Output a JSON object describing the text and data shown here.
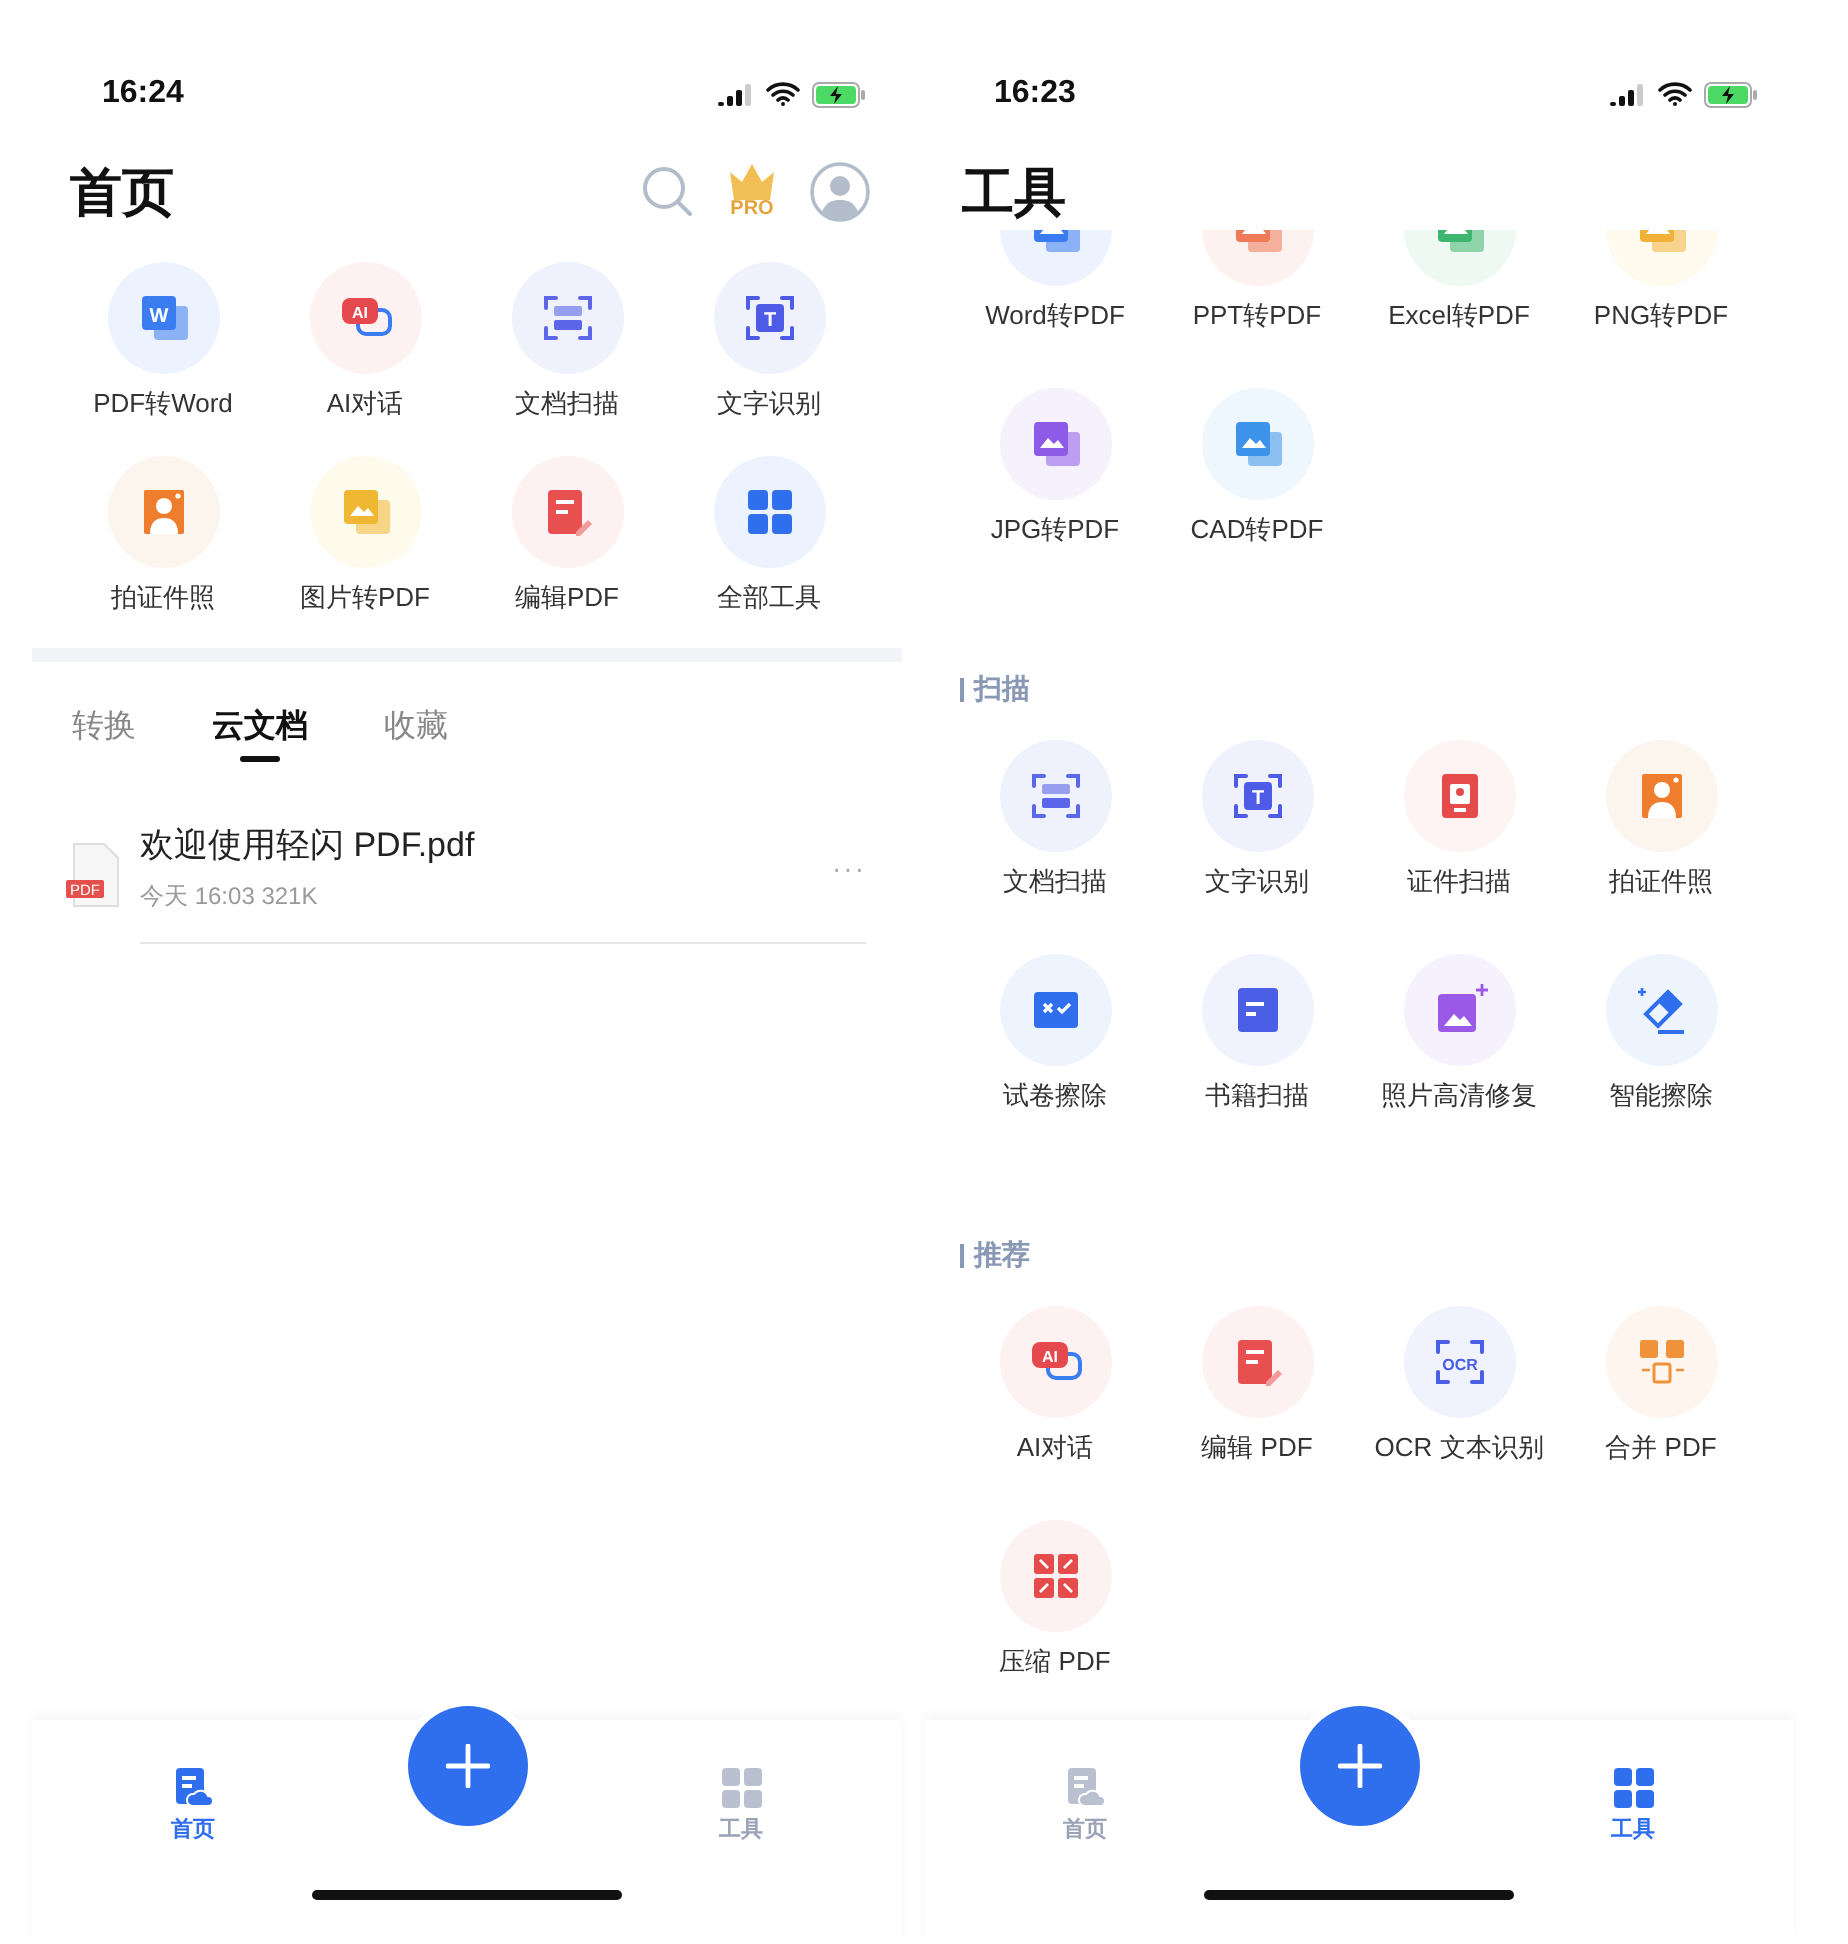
{
  "screens": [
    {
      "kind": "home",
      "status_bar": {
        "time": "16:24"
      },
      "title": "首页",
      "pro_badge": "PRO",
      "tools": [
        {
          "kind": "word",
          "label": "PDF转Word",
          "icon_text": "W"
        },
        {
          "kind": "ai",
          "label": "AI对话",
          "icon_text": "AI"
        },
        {
          "kind": "scan",
          "label": "文档扫描"
        },
        {
          "kind": "text",
          "label": "文字识别",
          "icon_text": "T"
        },
        {
          "kind": "idphoto",
          "label": "拍证件照"
        },
        {
          "kind": "image",
          "label": "图片转PDF"
        },
        {
          "kind": "edit",
          "label": "编辑PDF"
        },
        {
          "kind": "grid",
          "label": "全部工具"
        }
      ],
      "tabs": [
        {
          "label": "转换",
          "selected": false
        },
        {
          "label": "云文档",
          "selected": true
        },
        {
          "label": "收藏",
          "selected": false
        }
      ],
      "files": [
        {
          "name": "欢迎使用轻闪 PDF.pdf",
          "meta": "今天 16:03 321K",
          "badge": "PDF",
          "more": "···"
        }
      ],
      "bottom_nav": [
        {
          "kind": "home",
          "label": "首页",
          "selected": true
        },
        {
          "kind": "tools",
          "label": "工具",
          "selected": false
        }
      ]
    },
    {
      "kind": "tools",
      "status_bar": {
        "time": "16:23"
      },
      "title": "工具",
      "sections": [
        {
          "tools": [
            {
              "kind": "word",
              "label": "Word转PDF"
            },
            {
              "kind": "ppt",
              "label": "PPT转PDF"
            },
            {
              "kind": "excel",
              "label": "Excel转PDF"
            },
            {
              "kind": "png",
              "label": "PNG转PDF"
            },
            {
              "kind": "jpg",
              "label": "JPG转PDF"
            },
            {
              "kind": "cad",
              "label": "CAD转PDF"
            }
          ]
        },
        {
          "title": "扫描",
          "tools": [
            {
              "kind": "scan",
              "label": "文档扫描"
            },
            {
              "kind": "text",
              "label": "文字识别",
              "icon_text": "T"
            },
            {
              "kind": "card",
              "label": "证件扫描"
            },
            {
              "kind": "idphoto",
              "label": "拍证件照"
            },
            {
              "kind": "exam",
              "label": "试卷擦除"
            },
            {
              "kind": "book",
              "label": "书籍扫描"
            },
            {
              "kind": "photofix",
              "label": "照片高清修复"
            },
            {
              "kind": "eraser",
              "label": "智能擦除"
            }
          ]
        },
        {
          "title": "推荐",
          "tools": [
            {
              "kind": "ai",
              "label": "AI对话",
              "icon_text": "AI"
            },
            {
              "kind": "edit",
              "label": "编辑 PDF"
            },
            {
              "kind": "ocr",
              "label": "OCR 文本识别",
              "icon_text": "OCR"
            },
            {
              "kind": "merge",
              "label": "合并 PDF"
            },
            {
              "kind": "compress",
              "label": "压缩 PDF"
            }
          ]
        }
      ],
      "bottom_nav": [
        {
          "kind": "home",
          "label": "首页",
          "selected": false
        },
        {
          "kind": "tools",
          "label": "工具",
          "selected": true
        }
      ]
    }
  ]
}
